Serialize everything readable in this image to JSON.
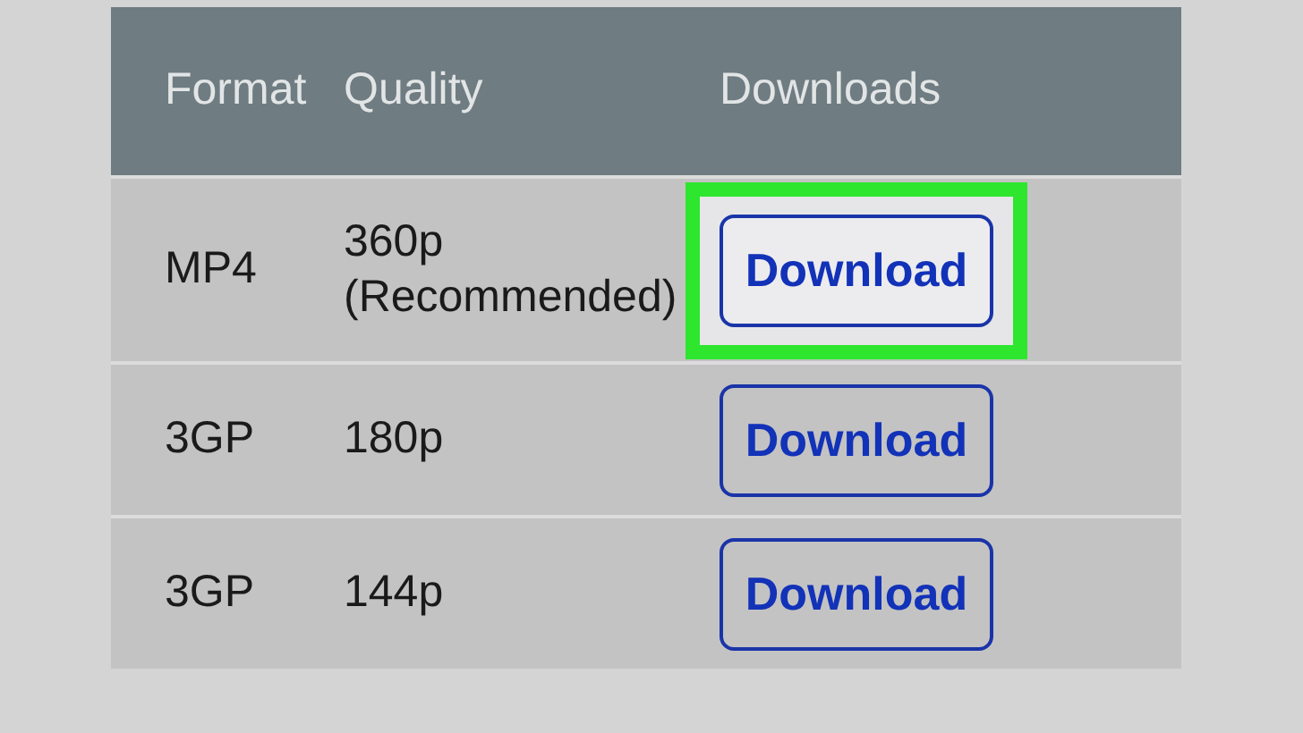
{
  "table": {
    "columns": [
      "Format",
      "Quality",
      "Downloads"
    ],
    "rows": [
      {
        "format": "MP4",
        "quality": "360p (Recommended)",
        "button": "Download",
        "highlighted": true
      },
      {
        "format": "3GP",
        "quality": "180p",
        "button": "Download",
        "highlighted": false
      },
      {
        "format": "3GP",
        "quality": "144p",
        "button": "Download",
        "highlighted": false
      }
    ]
  }
}
